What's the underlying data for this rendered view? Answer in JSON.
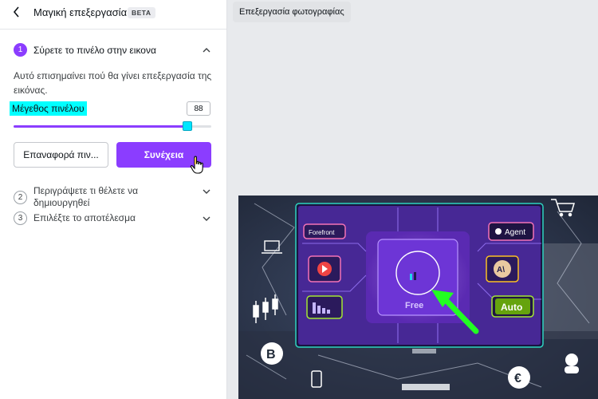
{
  "header": {
    "title": "Μαγική επεξεργασία",
    "badge": "BETA"
  },
  "steps": [
    {
      "number": "1",
      "label": "Σύρετε το πινέλο στην εικονα"
    },
    {
      "number": "2",
      "label_line1": "Περιγράψετε τι θέλετε να",
      "label_line2": "δημιουργηθεί"
    },
    {
      "number": "3",
      "label": "Επιλέξτε το αποτέλεσμα"
    }
  ],
  "step1": {
    "description": "Αυτό επισημαίνει πού θα γίνει επεξεργασία της εικόνας.",
    "brush_label": "Μέγεθος πινέλου",
    "brush_size": "88",
    "slider_fraction": 0.88,
    "reset_label": "Επαναφορά πιν...",
    "continue_label": "Συνέχεια"
  },
  "toolbar": {
    "edit_photo_label": "Επεξεργασία φωτογραφίας"
  },
  "photo": {
    "app_labels": [
      "Forefront",
      "Agent",
      "Auto",
      "Free"
    ]
  },
  "colors": {
    "accent": "#8b3dff",
    "highlight": "#00ffff"
  }
}
